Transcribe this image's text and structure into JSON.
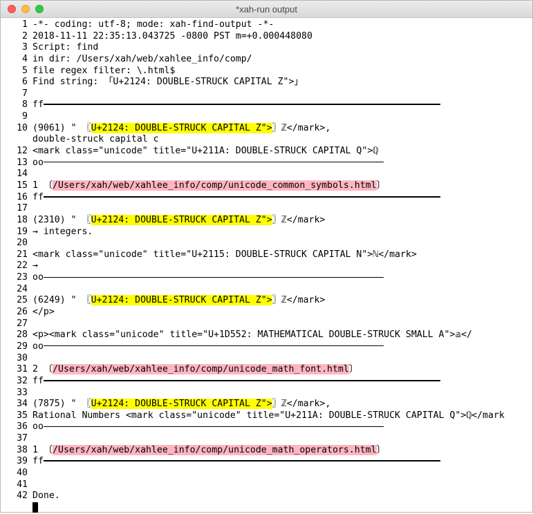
{
  "window": {
    "title": "*xah-run output"
  },
  "lines": [
    {
      "n": "1",
      "parts": [
        {
          "t": "-*- coding: utf-8; mode: xah-find-output -*-"
        }
      ]
    },
    {
      "n": "2",
      "parts": [
        {
          "t": "2018-11-11 22:35:13.043725 -0800 PST m=+0.000448080"
        }
      ]
    },
    {
      "n": "3",
      "parts": [
        {
          "t": "Script: find"
        }
      ]
    },
    {
      "n": "4",
      "parts": [
        {
          "t": "in dir: /Users/xah/web/xahlee_info/comp/"
        }
      ]
    },
    {
      "n": "5",
      "parts": [
        {
          "t": "file regex filter: \\.html$"
        }
      ]
    },
    {
      "n": "6",
      "parts": [
        {
          "t": "Find string: 「U+2124: DOUBLE-STRUCK CAPITAL Z\">」"
        }
      ]
    },
    {
      "n": "7",
      "parts": []
    },
    {
      "n": "8",
      "parts": [
        {
          "t": "ff"
        }
      ],
      "rule": "long"
    },
    {
      "n": "9",
      "parts": []
    },
    {
      "n": "10",
      "parts": [
        {
          "t": "(9061) \" 〖"
        },
        {
          "t": "U+2124: DOUBLE-STRUCK CAPITAL Z\">",
          "hl": "y"
        },
        {
          "t": "〗ℤ</mark>,"
        }
      ]
    },
    {
      "n": "",
      "parts": [
        {
          "t": "double-struck capital c"
        }
      ]
    },
    {
      "n": "12",
      "parts": [
        {
          "t": "<mark class=\"unicode\" title=\"U+211A: DOUBLE-STRUCK CAPITAL Q\">ℚ"
        }
      ]
    },
    {
      "n": "13",
      "parts": [
        {
          "t": "oo"
        }
      ],
      "rule": "short"
    },
    {
      "n": "14",
      "parts": []
    },
    {
      "n": "15",
      "parts": [
        {
          "t": "1 〔"
        },
        {
          "t": "/Users/xah/web/xahlee_info/comp/unicode_common_symbols.html",
          "hl": "r"
        },
        {
          "t": "〕"
        }
      ]
    },
    {
      "n": "16",
      "parts": [
        {
          "t": "ff"
        }
      ],
      "rule": "long"
    },
    {
      "n": "17",
      "parts": []
    },
    {
      "n": "18",
      "parts": [
        {
          "t": "(2310) \" 〖"
        },
        {
          "t": "U+2124: DOUBLE-STRUCK CAPITAL Z\">",
          "hl": "y"
        },
        {
          "t": "〗ℤ</mark>"
        }
      ]
    },
    {
      "n": "19",
      "parts": [
        {
          "t": "→ integers."
        }
      ]
    },
    {
      "n": "20",
      "parts": []
    },
    {
      "n": "21",
      "parts": [
        {
          "t": "<mark class=\"unicode\" title=\"U+2115: DOUBLE-STRUCK CAPITAL N\">ℕ</mark>"
        }
      ]
    },
    {
      "n": "22",
      "parts": [
        {
          "t": "→"
        }
      ]
    },
    {
      "n": "23",
      "parts": [
        {
          "t": "oo"
        }
      ],
      "rule": "short"
    },
    {
      "n": "24",
      "parts": []
    },
    {
      "n": "25",
      "parts": [
        {
          "t": "(6249) \" 〖"
        },
        {
          "t": "U+2124: DOUBLE-STRUCK CAPITAL Z\">",
          "hl": "y"
        },
        {
          "t": "〗ℤ</mark>"
        }
      ]
    },
    {
      "n": "26",
      "parts": [
        {
          "t": "</p>"
        }
      ]
    },
    {
      "n": "27",
      "parts": []
    },
    {
      "n": "28",
      "parts": [
        {
          "t": "<p><mark class=\"unicode\" title=\"U+1D552: MATHEMATICAL DOUBLE-STRUCK SMALL A\">𝕒</"
        }
      ]
    },
    {
      "n": "29",
      "parts": [
        {
          "t": "oo"
        }
      ],
      "rule": "short"
    },
    {
      "n": "30",
      "parts": []
    },
    {
      "n": "31",
      "parts": [
        {
          "t": "2 〔"
        },
        {
          "t": "/Users/xah/web/xahlee_info/comp/unicode_math_font.html",
          "hl": "r"
        },
        {
          "t": "〕"
        }
      ]
    },
    {
      "n": "32",
      "parts": [
        {
          "t": "ff"
        }
      ],
      "rule": "long"
    },
    {
      "n": "33",
      "parts": []
    },
    {
      "n": "34",
      "parts": [
        {
          "t": "(7875) \" 〖"
        },
        {
          "t": "U+2124: DOUBLE-STRUCK CAPITAL Z\">",
          "hl": "y"
        },
        {
          "t": "〗ℤ</mark>,"
        }
      ]
    },
    {
      "n": "35",
      "parts": [
        {
          "t": "Rational Numbers <mark class=\"unicode\" title=\"U+211A: DOUBLE-STRUCK CAPITAL Q\">ℚ</mark"
        }
      ]
    },
    {
      "n": "36",
      "parts": [
        {
          "t": "oo"
        }
      ],
      "rule": "short"
    },
    {
      "n": "37",
      "parts": []
    },
    {
      "n": "38",
      "parts": [
        {
          "t": "1 〔"
        },
        {
          "t": "/Users/xah/web/xahlee_info/comp/unicode_math_operators.html",
          "hl": "r"
        },
        {
          "t": "〕"
        }
      ]
    },
    {
      "n": "39",
      "parts": [
        {
          "t": "ff"
        }
      ],
      "rule": "long"
    },
    {
      "n": "40",
      "parts": []
    },
    {
      "n": "41",
      "parts": []
    },
    {
      "n": "42",
      "parts": [
        {
          "t": "Done."
        }
      ]
    },
    {
      "n": "",
      "parts": [],
      "cursor": true
    }
  ]
}
